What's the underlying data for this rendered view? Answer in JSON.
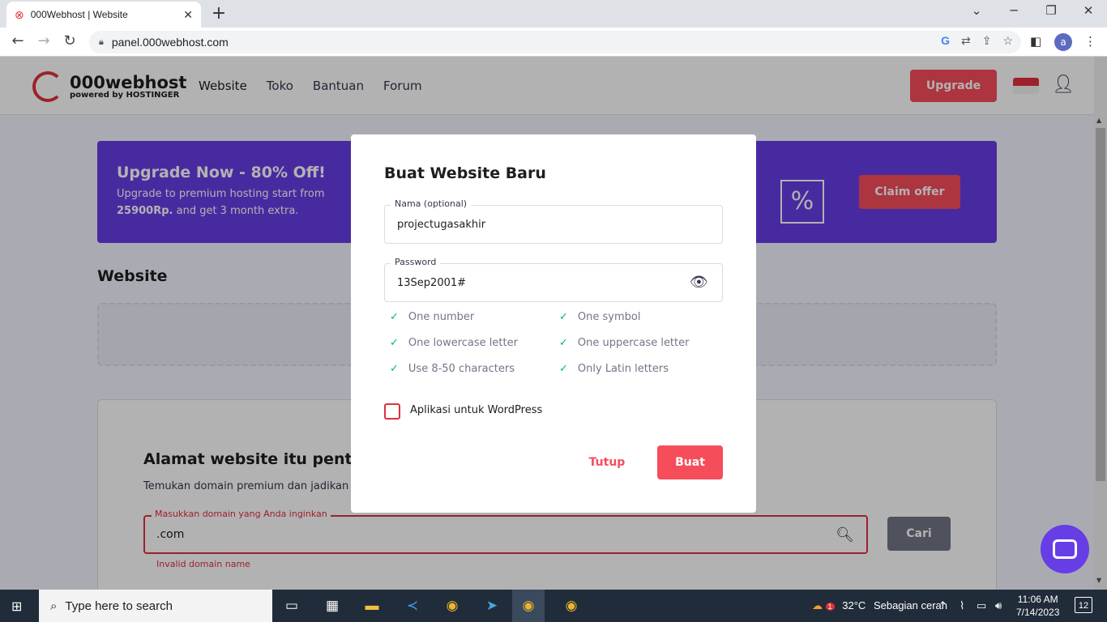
{
  "browser": {
    "tab_title": "000Webhost | Website",
    "url": "panel.000webhost.com",
    "profile_initial": "a"
  },
  "site": {
    "logo_name": "000webhost",
    "logo_sub": "powered by HOSTINGER",
    "nav": [
      "Website",
      "Toko",
      "Bantuan",
      "Forum"
    ],
    "upgrade_label": "Upgrade"
  },
  "banner": {
    "headline": "Upgrade Now - 80% Off!",
    "line1": "Upgrade to premium hosting start from",
    "price": "25900Rp.",
    "line2_rest": " and get 3 month extra.",
    "percent_symbol": "%",
    "claim_label": "Claim offer"
  },
  "section_title": "Website",
  "domain": {
    "headline": "Alamat website itu penting",
    "subtext": "Temukan domain premium dan jadikan w",
    "label": "Masukkan domain yang Anda inginkan",
    "value": ".com",
    "search_label": "Cari",
    "error": "Invalid domain name"
  },
  "modal": {
    "title": "Buat Website Baru",
    "name_label": "Nama (optional)",
    "name_value": "projectugasakhir",
    "password_label": "Password",
    "password_value": "13Sep2001#",
    "requirements": [
      "One number",
      "One symbol",
      "One lowercase letter",
      "One uppercase letter",
      "Use 8-50 characters",
      "Only Latin letters"
    ],
    "wordpress_label": "Aplikasi untuk WordPress",
    "close_label": "Tutup",
    "create_label": "Buat"
  },
  "taskbar": {
    "search_placeholder": "Type here to search",
    "weather_temp": "32°C",
    "weather_text": "Sebagian cerah",
    "weather_badge": "1",
    "time": "11:06 AM",
    "date": "7/14/2023",
    "notifications": "12"
  },
  "colors": {
    "accent": "#f64d5b",
    "brand_purple": "#673de6",
    "check_green": "#00b090"
  }
}
